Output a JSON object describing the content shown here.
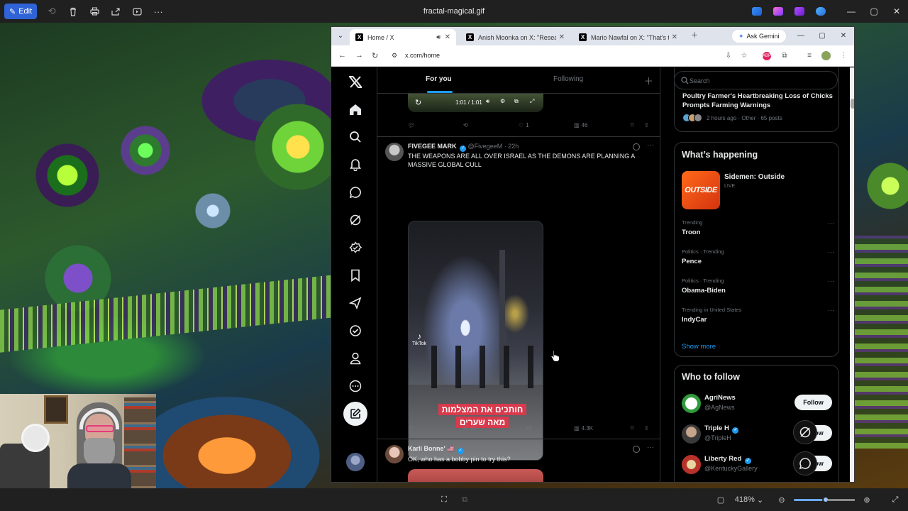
{
  "viewer": {
    "edit_label": "Edit",
    "file_title": "fractal-magical.gif",
    "zoom": "418%"
  },
  "browser": {
    "tabs": [
      {
        "label": "Home / X"
      },
      {
        "label": "Anish Moonka on X: \"Research"
      },
      {
        "label": "Mario Nawfal on X: \"That's the"
      }
    ],
    "gemini_label": "Ask Gemini",
    "url": "x.com/home"
  },
  "timeline": {
    "tab_foryou": "For you",
    "tab_following": "Following",
    "top_player": {
      "time": "1:01 / 1:01"
    },
    "top_actions": {
      "likes": "1",
      "views": "46"
    },
    "tweets": [
      {
        "name": "FIVEGEE MARK",
        "handle_time": "@FivegeeM · 22h",
        "text": "THE WEAPONS ARE ALL OVER ISRAEL AS THE DEMONS ARE PLANNING A MASSIVE GLOBAL  CULL",
        "tiktok": "TikTok",
        "caption_line1": "חותכים את המצלמות",
        "caption_line2": "מאה שערים",
        "actions": {
          "retweets": "10",
          "likes": "26",
          "views": "4.3K"
        }
      },
      {
        "name": "Karli Bonne'",
        "handle_time": "@KarluskaP · 12h",
        "text": "OK, who has a bobby pin to try this?"
      }
    ]
  },
  "sidebar": {
    "search_placeholder": "Search",
    "news": {
      "headline": "Poultry Farmer's Heartbreaking Loss of Chicks Prompts Farming Warnings",
      "meta": "2 hours ago · Other · 65 posts"
    },
    "happening": {
      "title": "What’s happening",
      "event": {
        "title": "Sidemen: Outside",
        "status": "LIVE",
        "thumb_text": "OUTSIDE"
      },
      "trends": [
        {
          "meta": "Trending",
          "name": "Troon"
        },
        {
          "meta": "Politics · Trending",
          "name": "Pence"
        },
        {
          "meta": "Politics · Trending",
          "name": "Obama-Biden"
        },
        {
          "meta": "Trending in United States",
          "name": "IndyCar"
        }
      ],
      "show_more": "Show more"
    },
    "who_to_follow": {
      "title": "Who to follow",
      "accounts": [
        {
          "name": "AgriNews",
          "handle": "@AgNews",
          "button": "Follow"
        },
        {
          "name": "Triple H",
          "handle": "@TripleH",
          "button": "Follow"
        },
        {
          "name": "Liberty Red",
          "handle": "@KentuckyGallery",
          "button": "Follow"
        }
      ]
    }
  },
  "colors": {
    "accent": "#1d9bf0",
    "background": "#000000",
    "viewer_chrome": "#202020"
  }
}
